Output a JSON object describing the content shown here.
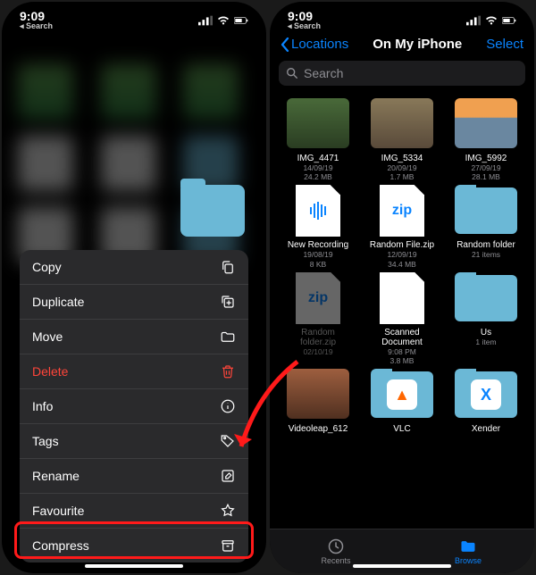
{
  "status": {
    "time": "9:09",
    "back_label": "◂ Search"
  },
  "left": {
    "menu": [
      {
        "label": "Copy",
        "icon": "copy-icon",
        "interactable": true
      },
      {
        "label": "Duplicate",
        "icon": "duplicate-icon",
        "interactable": true
      },
      {
        "label": "Move",
        "icon": "folder-icon",
        "interactable": true
      },
      {
        "label": "Delete",
        "icon": "trash-icon",
        "interactable": true,
        "destructive": true
      },
      {
        "label": "Info",
        "icon": "info-icon",
        "interactable": true
      },
      {
        "label": "Tags",
        "icon": "tag-icon",
        "interactable": true
      },
      {
        "label": "Rename",
        "icon": "edit-icon",
        "interactable": true
      },
      {
        "label": "Favourite",
        "icon": "star-icon",
        "interactable": true
      },
      {
        "label": "Compress",
        "icon": "archive-icon",
        "interactable": true,
        "highlighted": true
      }
    ]
  },
  "right": {
    "nav": {
      "back": "Locations",
      "title": "On My iPhone",
      "select": "Select"
    },
    "search_placeholder": "Search",
    "files": [
      {
        "name": "IMG_4471",
        "date": "14/09/19",
        "size": "24.2 MB",
        "thumb": "thumb-img1"
      },
      {
        "name": "IMG_5334",
        "date": "20/09/19",
        "size": "1.7 MB",
        "thumb": "thumb-img2"
      },
      {
        "name": "IMG_5992",
        "date": "27/09/19",
        "size": "28.1 MB",
        "thumb": "thumb-img3"
      },
      {
        "name": "New Recording",
        "date": "19/08/19",
        "size": "8 KB",
        "thumb": "audio"
      },
      {
        "name": "Random File.zip",
        "date": "12/09/19",
        "size": "34.4 MB",
        "thumb": "zip"
      },
      {
        "name": "Random folder",
        "meta": "21 items",
        "thumb": "folder"
      },
      {
        "name": "Random folder.zip",
        "date": "02/10/19",
        "size": "",
        "thumb": "zip",
        "dim": true
      },
      {
        "name": "Scanned Document",
        "date": "9:08 PM",
        "size": "3.8 MB",
        "thumb": "scan"
      },
      {
        "name": "Us",
        "meta": "1 item",
        "thumb": "folder"
      },
      {
        "name": "Videoleap_612",
        "thumb": "thumb-video",
        "cut": true
      },
      {
        "name": "VLC",
        "thumb": "folder-vlc",
        "cut": true
      },
      {
        "name": "Xender",
        "thumb": "folder-x",
        "cut": true
      }
    ],
    "tabs": {
      "recents": "Recents",
      "browse": "Browse"
    }
  }
}
